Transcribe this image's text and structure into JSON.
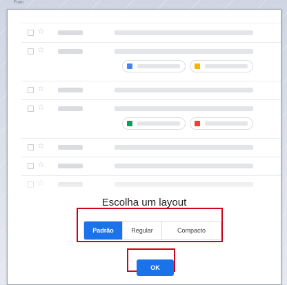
{
  "header": {
    "from_label": "From"
  },
  "preview": {
    "attachment_icons": [
      "docs-icon",
      "slides-icon",
      "sheets-icon",
      "image-icon"
    ]
  },
  "dialog": {
    "title": "Escolha um layout",
    "options": [
      {
        "label": "Padrão",
        "selected": true
      },
      {
        "label": "Regular",
        "selected": false
      },
      {
        "label": "Compacto",
        "selected": false
      }
    ],
    "ok_label": "OK"
  },
  "colors": {
    "accent": "#1a73e8",
    "highlight": "#d0021b",
    "docs": "#4285f4",
    "slides": "#f4b400",
    "sheets": "#0f9d58",
    "image": "#ea4335"
  }
}
